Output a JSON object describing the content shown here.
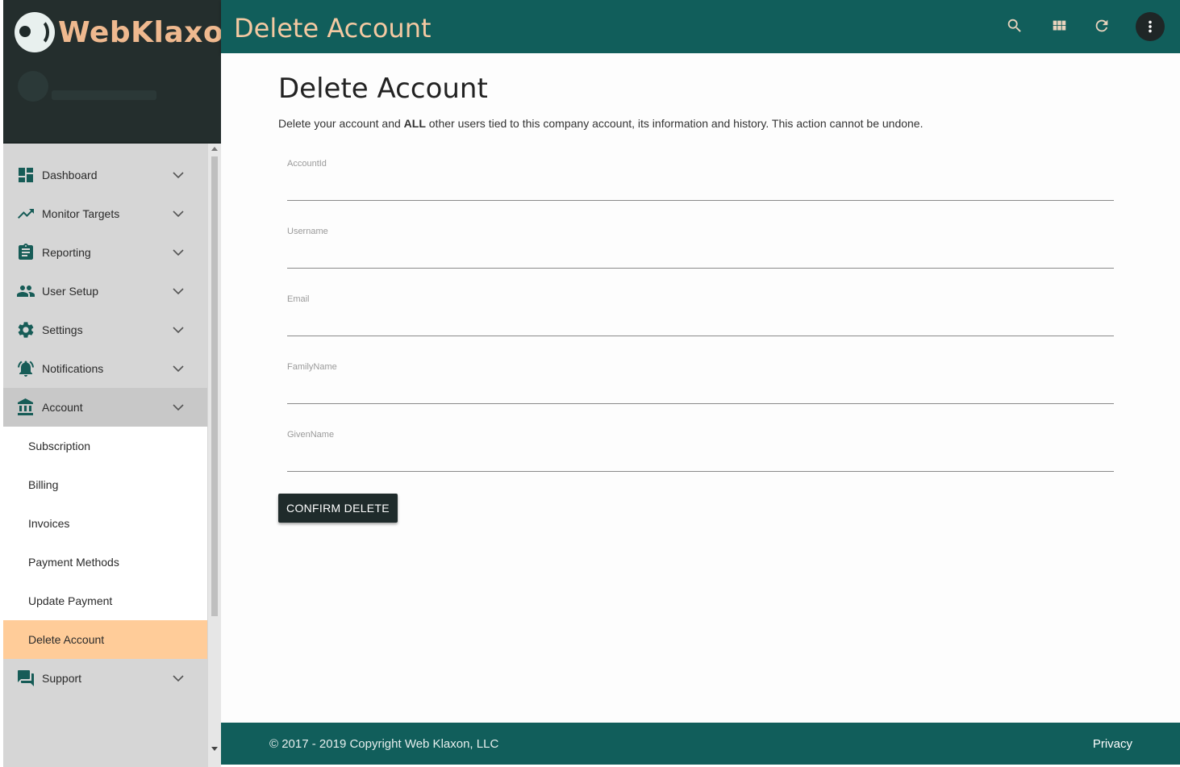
{
  "brand": {
    "name": "WebKlaxon"
  },
  "header": {
    "title": "Delete Account",
    "icons": [
      "search-icon",
      "grid-icon",
      "refresh-icon",
      "more-vert-icon"
    ]
  },
  "sidebar": {
    "items": [
      {
        "label": "Dashboard",
        "icon": "dashboard-icon"
      },
      {
        "label": "Monitor Targets",
        "icon": "trending-up-icon"
      },
      {
        "label": "Reporting",
        "icon": "clipboard-icon"
      },
      {
        "label": "User Setup",
        "icon": "people-icon"
      },
      {
        "label": "Settings",
        "icon": "gear-icon"
      },
      {
        "label": "Notifications",
        "icon": "bell-icon"
      },
      {
        "label": "Account",
        "icon": "bank-icon"
      }
    ],
    "account_subitems": [
      {
        "label": "Subscription"
      },
      {
        "label": "Billing"
      },
      {
        "label": "Invoices"
      },
      {
        "label": "Payment Methods"
      },
      {
        "label": "Update Payment"
      },
      {
        "label": "Delete Account"
      }
    ],
    "support": {
      "label": "Support",
      "icon": "forum-icon"
    }
  },
  "main": {
    "heading": "Delete Account",
    "description_pre": "Delete your account and ",
    "description_bold": "ALL",
    "description_post": " other users tied to this company account, its information and history. This action cannot be undone.",
    "fields": [
      {
        "label": "AccountId",
        "value": ""
      },
      {
        "label": "Username",
        "value": ""
      },
      {
        "label": "Email",
        "value": ""
      },
      {
        "label": "FamilyName",
        "value": ""
      },
      {
        "label": "GivenName",
        "value": ""
      }
    ],
    "confirm_label": "CONFIRM DELETE"
  },
  "footer": {
    "copyright": "© 2017 - 2019 Copyright Web Klaxon, LLC",
    "privacy": "Privacy"
  },
  "colors": {
    "teal": "#115e5b",
    "brand_orange": "#efb98f",
    "selected_bg": "#ffcc99",
    "sidebar_bg": "#d6d6d6",
    "nav_icon": "#175c57"
  }
}
